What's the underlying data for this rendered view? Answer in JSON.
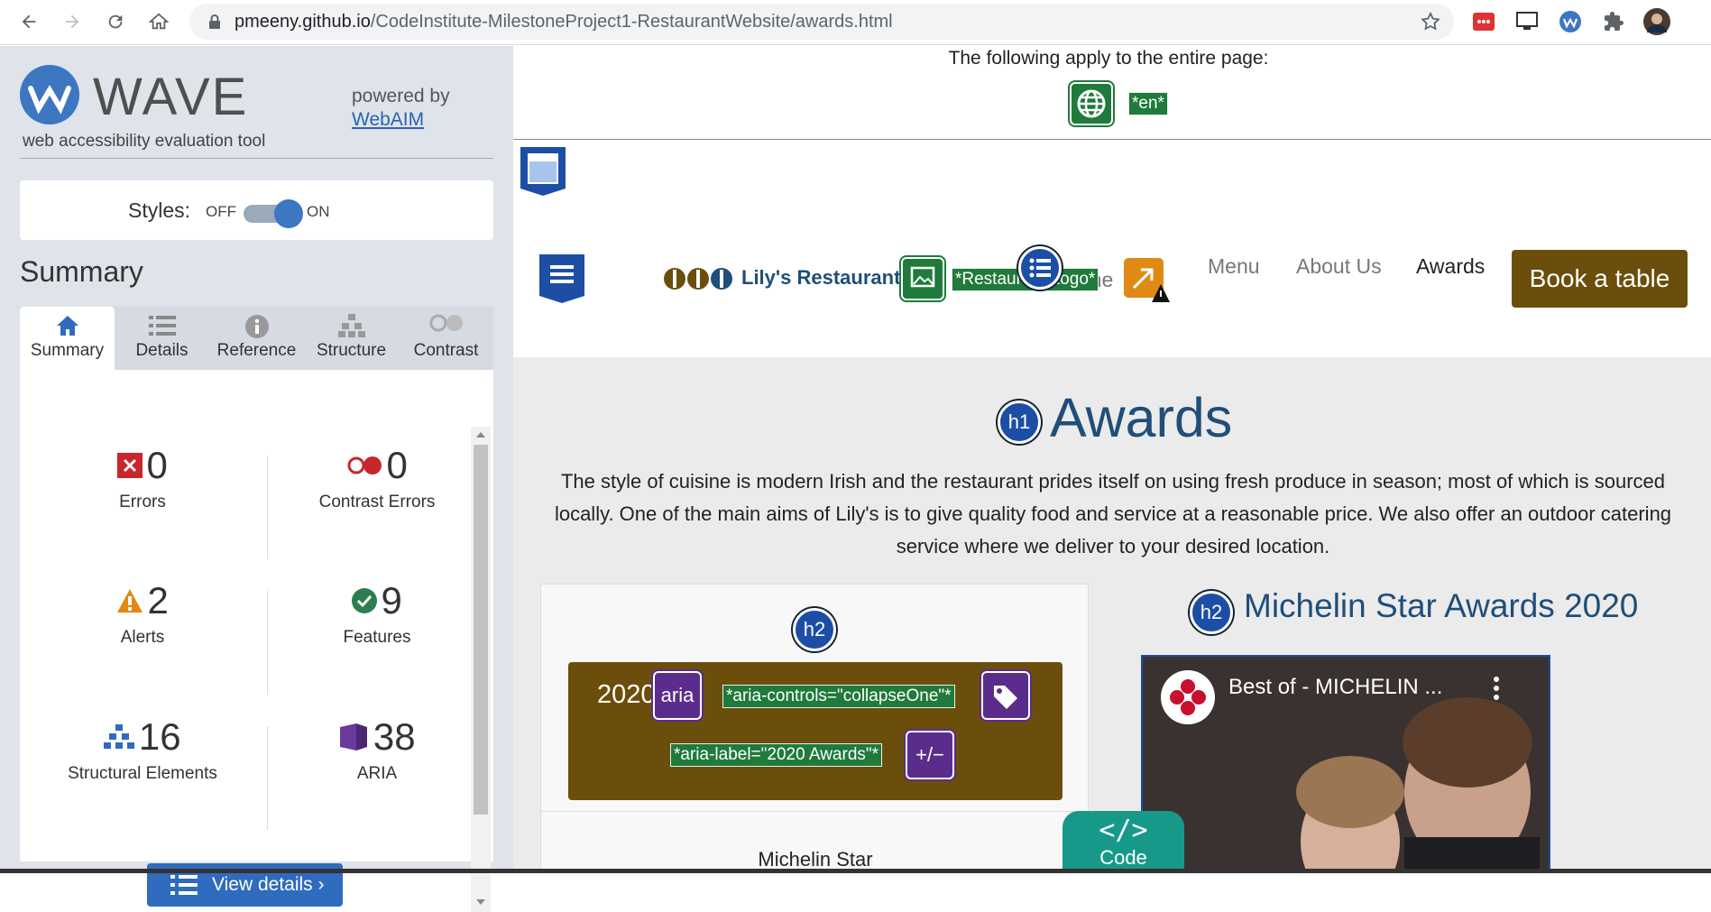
{
  "browser": {
    "url_domain": "pmeeny.github.io",
    "url_path": "/CodeInstitute-MilestoneProject1-RestaurantWebsite/awards.html"
  },
  "wave": {
    "logo_text": "WAVE",
    "tagline": "web accessibility evaluation tool",
    "powered_by": "powered by",
    "webaim_link": "WebAIM",
    "styles_label": "Styles:",
    "styles_off": "OFF",
    "styles_on": "ON",
    "summary_heading": "Summary",
    "tabs": [
      {
        "label": "Summary"
      },
      {
        "label": "Details"
      },
      {
        "label": "Reference"
      },
      {
        "label": "Structure"
      },
      {
        "label": "Contrast"
      }
    ],
    "stats": {
      "errors": {
        "count": "0",
        "label": "Errors"
      },
      "contrast_errors": {
        "count": "0",
        "label": "Contrast Errors"
      },
      "alerts": {
        "count": "2",
        "label": "Alerts"
      },
      "features": {
        "count": "9",
        "label": "Features"
      },
      "structural": {
        "count": "16",
        "label": "Structural Elements"
      },
      "aria": {
        "count": "38",
        "label": "ARIA"
      }
    },
    "view_details": "View details ›"
  },
  "site": {
    "applies_text": "The following apply to the entire page:",
    "lang_tag": "*en*",
    "brand": "Lily's Restaurant",
    "logo_alt_tag": "*Restaurant Logo*",
    "home_overlap": "Home",
    "nav": {
      "menu": "Menu",
      "about": "About Us",
      "awards": "Awards"
    },
    "book_button": "Book a table",
    "h1_badge": "h1",
    "page_heading": "Awards",
    "intro": "The style of cuisine is modern Irish and the restaurant prides itself on using fresh produce in season; most of which is sourced locally. One of the main aims of Lily's is to give quality food and service at a reasonable price. We also offer an outdoor catering service where we deliver to your desired location.",
    "h2_badge": "h2",
    "accordion_year": "2020",
    "aria_badge": "aria",
    "aria_controls_tag": "*aria-controls=\"collapseOne\"*",
    "aria_label_tag": "*aria-label=\"2020 Awards\"*",
    "toggle_badge": "+/−",
    "card_label": "Michelin Star",
    "right_heading": "Michelin Star Awards 2020",
    "video_title": "Best of - MICHELIN ...",
    "code_symbol": "</>",
    "code_label": "Code"
  }
}
